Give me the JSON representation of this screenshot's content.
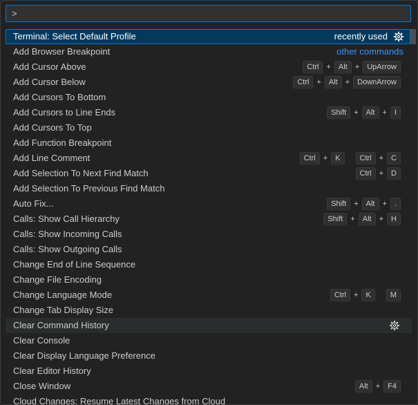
{
  "quick_input": {
    "value": ">"
  },
  "selected": {
    "label": "Terminal: Select Default Profile",
    "tag": "recently used"
  },
  "other_commands_label": "other commands",
  "items": [
    {
      "label": "Add Browser Breakpoint",
      "keys": []
    },
    {
      "label": "Add Cursor Above",
      "keys": [
        [
          "Ctrl",
          "Alt",
          "UpArrow"
        ]
      ]
    },
    {
      "label": "Add Cursor Below",
      "keys": [
        [
          "Ctrl",
          "Alt",
          "DownArrow"
        ]
      ]
    },
    {
      "label": "Add Cursors To Bottom",
      "keys": []
    },
    {
      "label": "Add Cursors to Line Ends",
      "keys": [
        [
          "Shift",
          "Alt",
          "I"
        ]
      ]
    },
    {
      "label": "Add Cursors To Top",
      "keys": []
    },
    {
      "label": "Add Function Breakpoint",
      "keys": []
    },
    {
      "label": "Add Line Comment",
      "keys": [
        [
          "Ctrl",
          "K"
        ],
        [
          "Ctrl",
          "C"
        ]
      ]
    },
    {
      "label": "Add Selection To Next Find Match",
      "keys": [
        [
          "Ctrl",
          "D"
        ]
      ]
    },
    {
      "label": "Add Selection To Previous Find Match",
      "keys": []
    },
    {
      "label": "Auto Fix...",
      "keys": [
        [
          "Shift",
          "Alt",
          "."
        ]
      ]
    },
    {
      "label": "Calls: Show Call Hierarchy",
      "keys": [
        [
          "Shift",
          "Alt",
          "H"
        ]
      ]
    },
    {
      "label": "Calls: Show Incoming Calls",
      "keys": []
    },
    {
      "label": "Calls: Show Outgoing Calls",
      "keys": []
    },
    {
      "label": "Change End of Line Sequence",
      "keys": []
    },
    {
      "label": "Change File Encoding",
      "keys": []
    },
    {
      "label": "Change Language Mode",
      "keys": [
        [
          "Ctrl",
          "K"
        ],
        [
          "M"
        ]
      ]
    },
    {
      "label": "Change Tab Display Size",
      "keys": []
    },
    {
      "label": "Clear Command History",
      "keys": [],
      "hover": true,
      "gear": true
    },
    {
      "label": "Clear Console",
      "keys": []
    },
    {
      "label": "Clear Display Language Preference",
      "keys": []
    },
    {
      "label": "Clear Editor History",
      "keys": []
    },
    {
      "label": "Close Window",
      "keys": [
        [
          "Alt",
          "F4"
        ]
      ]
    },
    {
      "label": "Cloud Changes: Resume Latest Changes from Cloud",
      "keys": []
    }
  ]
}
